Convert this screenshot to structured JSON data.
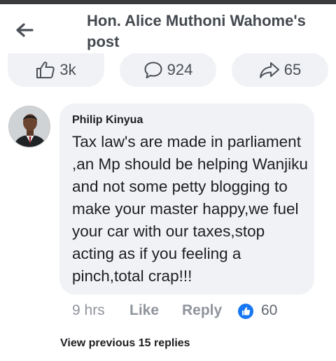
{
  "header": {
    "title": "Hon. Alice Muthoni Wahome's post",
    "back_icon": "arrow-left-icon"
  },
  "actions": {
    "like": {
      "icon": "thumbs-up-icon",
      "count": "3k"
    },
    "comment": {
      "icon": "comment-bubble-icon",
      "count": "924"
    },
    "share": {
      "icon": "share-arrow-icon",
      "count": "65"
    }
  },
  "comment": {
    "author": "Philip Kinyua",
    "text": "Tax law's are made in parliament ,an Mp should be helping Wanjiku and not some petty blogging to make your master happy,we fuel your car with our taxes,stop acting as if you feeling a pinch,total crap!!!",
    "time": "9 hrs",
    "like_label": "Like",
    "reply_label": "Reply",
    "reaction_icon": "like-reaction-icon",
    "reaction_count": "60"
  },
  "replies": {
    "view_previous": "View previous 15 replies"
  },
  "colors": {
    "topbar": "#3a3b3c",
    "pill_bg": "#f0f2f5",
    "bubble_bg": "#f0f2f5",
    "meta_text": "#90949c",
    "like_blue": "#1877f2"
  }
}
